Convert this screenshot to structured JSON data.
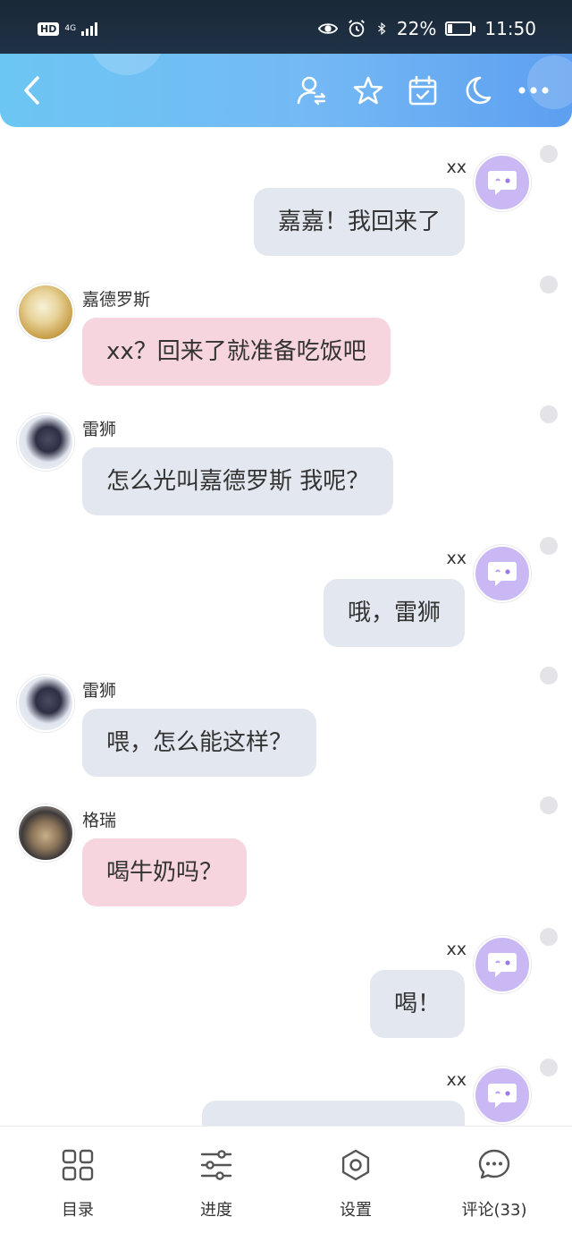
{
  "status_bar": {
    "hd": "HD",
    "network": "4G",
    "battery_percent": "22%",
    "battery_level": 0.22,
    "time": "11:50"
  },
  "header": {
    "icons": [
      "back-arrow-icon",
      "switch-user-icon",
      "star-icon",
      "calendar-check-icon",
      "moon-icon",
      "more-icon"
    ]
  },
  "messages": [
    {
      "side": "right",
      "name": "xx",
      "text": "嘉嘉！我回来了",
      "color": "grey",
      "avatar": "me"
    },
    {
      "side": "left",
      "name": "嘉德罗斯",
      "text": "xx？回来了就准备吃饭吧",
      "color": "pink",
      "avatar": "jiadeluosi"
    },
    {
      "side": "left",
      "name": "雷狮",
      "text": "怎么光叫嘉德罗斯 我呢？",
      "color": "grey",
      "avatar": "leishi"
    },
    {
      "side": "right",
      "name": "xx",
      "text": "哦，雷狮",
      "color": "grey",
      "avatar": "me"
    },
    {
      "side": "left",
      "name": "雷狮",
      "text": "喂，怎么能这样？",
      "color": "grey",
      "avatar": "leishi"
    },
    {
      "side": "left",
      "name": "格瑞",
      "text": "喝牛奶吗？",
      "color": "pink",
      "avatar": "gerui"
    },
    {
      "side": "right",
      "name": "xx",
      "text": "喝！",
      "color": "grey",
      "avatar": "me"
    },
    {
      "side": "right",
      "name": "xx",
      "text": "",
      "color": "grey",
      "avatar": "me"
    }
  ],
  "bottom_nav": [
    {
      "label": "目录",
      "icon": "grid-icon"
    },
    {
      "label": "进度",
      "icon": "sliders-icon"
    },
    {
      "label": "设置",
      "icon": "gear-icon"
    },
    {
      "label": "评论(33)",
      "icon": "comment-icon"
    }
  ],
  "colors": {
    "header_start": "#6cc6f3",
    "header_end": "#5d9ff0",
    "bubble_grey": "#e3e7ef",
    "bubble_pink": "#f7d5de",
    "my_avatar": "#c9b8f4"
  }
}
